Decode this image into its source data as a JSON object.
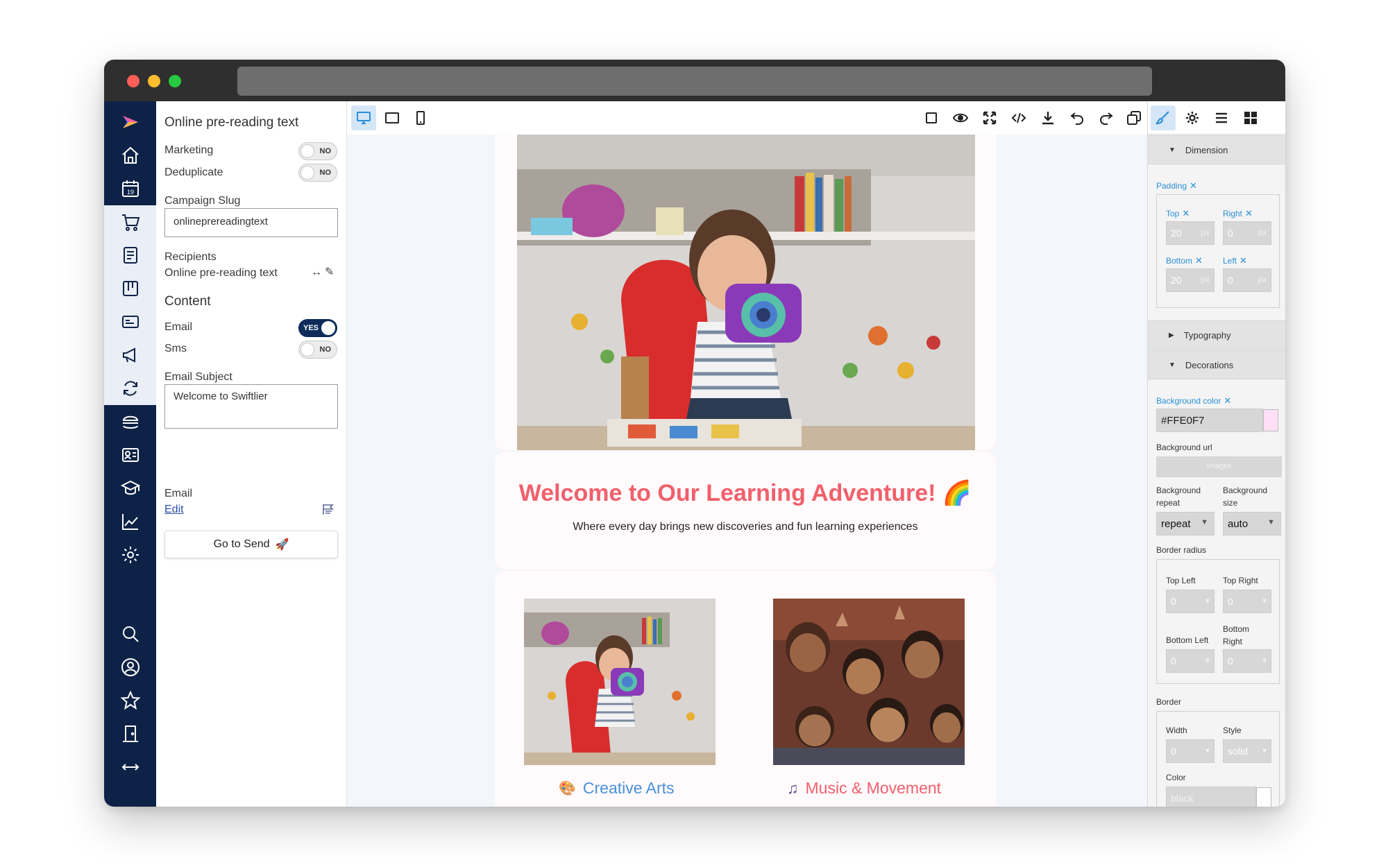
{
  "settings": {
    "campaign_name": "Online pre-reading text",
    "marketing_label": "Marketing",
    "marketing_toggle": "NO",
    "deduplicate_label": "Deduplicate",
    "deduplicate_toggle": "NO",
    "slug_label": "Campaign Slug",
    "slug_value": "onlineprereadingtext",
    "recipients_label": "Recipients",
    "recipients_value": "Online pre-reading text",
    "content_heading": "Content",
    "email_label": "Email",
    "email_toggle": "YES",
    "sms_label": "Sms",
    "sms_toggle": "NO",
    "subject_label": "Email Subject",
    "subject_value": "Welcome to Swiftlier",
    "email_section_label": "Email",
    "edit_link": "Edit",
    "send_button": "Go to Send"
  },
  "email_preview": {
    "title": "Welcome to Our Learning Adventure! 🌈",
    "subtitle": "Where every day brings new discoveries and fun learning experiences",
    "col_left_title": "Creative Arts",
    "col_right_title": "Music & Movement"
  },
  "style_panel": {
    "dimension_heading": "Dimension",
    "padding_label": "Padding",
    "top_label": "Top",
    "top_value": "20",
    "right_label": "Right",
    "right_value": "0",
    "bottom_label": "Bottom",
    "bottom_value": "20",
    "left_label": "Left",
    "left_value": "0",
    "unit": "px",
    "typography_heading": "Typography",
    "decorations_heading": "Decorations",
    "bg_color_label": "Background color",
    "bg_color_value": "#FFE0F7",
    "bg_url_label": "Background url",
    "bg_url_button": "Images",
    "bg_repeat_label": "Background repeat",
    "bg_repeat_value": "repeat",
    "bg_size_label": "Background size",
    "bg_size_value": "auto",
    "border_radius_label": "Border radius",
    "top_left_label": "Top Left",
    "top_right_label": "Top Right",
    "bottom_left_label": "Bottom Left",
    "bottom_right_label": "Bottom Right",
    "radius_value": "0",
    "border_label": "Border",
    "width_label": "Width",
    "width_value": "0",
    "style_label": "Style",
    "style_value": "solid",
    "color_label": "Color",
    "color_value": "black"
  },
  "colors": {
    "nav_bg": "#0d2246",
    "accent_blue": "#2a8fd6",
    "title_coral": "#f0606b",
    "swatch_pink": "#FFE0F7"
  },
  "icons": {
    "nav": [
      "logo-icon",
      "home-icon",
      "calendar-icon",
      "cart-icon",
      "form-icon",
      "board-icon",
      "id-card-icon",
      "megaphone-icon",
      "refresh-icon",
      "burger-icon",
      "contact-card-icon",
      "graduation-cap-icon",
      "chart-line-icon",
      "gear-icon",
      "search-icon",
      "user-icon",
      "star-icon",
      "door-icon",
      "resize-icon"
    ],
    "toolbar": [
      "desktop-icon",
      "tablet-icon",
      "mobile-icon",
      "square-icon",
      "eye-icon",
      "fullscreen-icon",
      "code-icon",
      "download-icon",
      "undo-icon",
      "redo-icon",
      "copy-icon"
    ]
  },
  "nav_calendar_day": "19"
}
